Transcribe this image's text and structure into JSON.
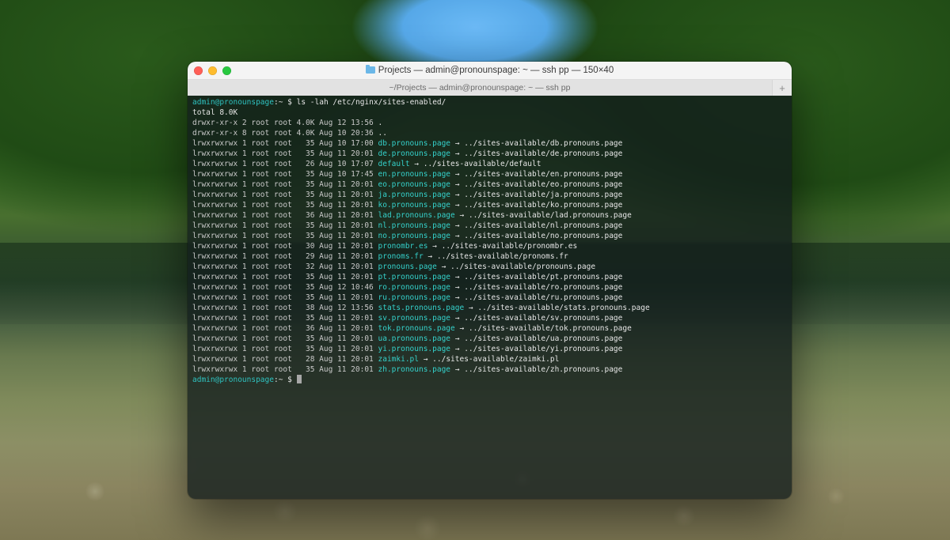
{
  "window": {
    "title_prefix_folder": "Projects",
    "title_rest": " — admin@pronounspage: ~ — ssh pp — 150×40",
    "tab_label": "~/Projects — admin@pronounspage: ~ — ssh pp",
    "add_tab_glyph": "+"
  },
  "prompt": {
    "user": "admin@pronounspage",
    "sep": ":",
    "path": "~",
    "dollar": "$"
  },
  "command1": "ls -lah /etc/nginx/sites-enabled/",
  "total_line": "total 8.0K",
  "entries": [
    {
      "perm": "drwxr-xr-x",
      "links": "2",
      "owner": "root",
      "group": "root",
      "size": "4.0K",
      "date": "Aug 12 13:56",
      "name": ".",
      "is_link": false,
      "target": ""
    },
    {
      "perm": "drwxr-xr-x",
      "links": "8",
      "owner": "root",
      "group": "root",
      "size": "4.0K",
      "date": "Aug 10 20:36",
      "name": "..",
      "is_link": false,
      "target": ""
    },
    {
      "perm": "lrwxrwxrwx",
      "links": "1",
      "owner": "root",
      "group": "root",
      "size": "35",
      "date": "Aug 10 17:00",
      "name": "db.pronouns.page",
      "is_link": true,
      "target": "../sites-available/db.pronouns.page"
    },
    {
      "perm": "lrwxrwxrwx",
      "links": "1",
      "owner": "root",
      "group": "root",
      "size": "35",
      "date": "Aug 11 20:01",
      "name": "de.pronouns.page",
      "is_link": true,
      "target": "../sites-available/de.pronouns.page"
    },
    {
      "perm": "lrwxrwxrwx",
      "links": "1",
      "owner": "root",
      "group": "root",
      "size": "26",
      "date": "Aug 10 17:07",
      "name": "default",
      "is_link": true,
      "target": "../sites-available/default"
    },
    {
      "perm": "lrwxrwxrwx",
      "links": "1",
      "owner": "root",
      "group": "root",
      "size": "35",
      "date": "Aug 10 17:45",
      "name": "en.pronouns.page",
      "is_link": true,
      "target": "../sites-available/en.pronouns.page"
    },
    {
      "perm": "lrwxrwxrwx",
      "links": "1",
      "owner": "root",
      "group": "root",
      "size": "35",
      "date": "Aug 11 20:01",
      "name": "eo.pronouns.page",
      "is_link": true,
      "target": "../sites-available/eo.pronouns.page"
    },
    {
      "perm": "lrwxrwxrwx",
      "links": "1",
      "owner": "root",
      "group": "root",
      "size": "35",
      "date": "Aug 11 20:01",
      "name": "ja.pronouns.page",
      "is_link": true,
      "target": "../sites-available/ja.pronouns.page"
    },
    {
      "perm": "lrwxrwxrwx",
      "links": "1",
      "owner": "root",
      "group": "root",
      "size": "35",
      "date": "Aug 11 20:01",
      "name": "ko.pronouns.page",
      "is_link": true,
      "target": "../sites-available/ko.pronouns.page"
    },
    {
      "perm": "lrwxrwxrwx",
      "links": "1",
      "owner": "root",
      "group": "root",
      "size": "36",
      "date": "Aug 11 20:01",
      "name": "lad.pronouns.page",
      "is_link": true,
      "target": "../sites-available/lad.pronouns.page"
    },
    {
      "perm": "lrwxrwxrwx",
      "links": "1",
      "owner": "root",
      "group": "root",
      "size": "35",
      "date": "Aug 11 20:01",
      "name": "nl.pronouns.page",
      "is_link": true,
      "target": "../sites-available/nl.pronouns.page"
    },
    {
      "perm": "lrwxrwxrwx",
      "links": "1",
      "owner": "root",
      "group": "root",
      "size": "35",
      "date": "Aug 11 20:01",
      "name": "no.pronouns.page",
      "is_link": true,
      "target": "../sites-available/no.pronouns.page"
    },
    {
      "perm": "lrwxrwxrwx",
      "links": "1",
      "owner": "root",
      "group": "root",
      "size": "30",
      "date": "Aug 11 20:01",
      "name": "pronombr.es",
      "is_link": true,
      "target": "../sites-available/pronombr.es"
    },
    {
      "perm": "lrwxrwxrwx",
      "links": "1",
      "owner": "root",
      "group": "root",
      "size": "29",
      "date": "Aug 11 20:01",
      "name": "pronoms.fr",
      "is_link": true,
      "target": "../sites-available/pronoms.fr"
    },
    {
      "perm": "lrwxrwxrwx",
      "links": "1",
      "owner": "root",
      "group": "root",
      "size": "32",
      "date": "Aug 11 20:01",
      "name": "pronouns.page",
      "is_link": true,
      "target": "../sites-available/pronouns.page"
    },
    {
      "perm": "lrwxrwxrwx",
      "links": "1",
      "owner": "root",
      "group": "root",
      "size": "35",
      "date": "Aug 11 20:01",
      "name": "pt.pronouns.page",
      "is_link": true,
      "target": "../sites-available/pt.pronouns.page"
    },
    {
      "perm": "lrwxrwxrwx",
      "links": "1",
      "owner": "root",
      "group": "root",
      "size": "35",
      "date": "Aug 12 10:46",
      "name": "ro.pronouns.page",
      "is_link": true,
      "target": "../sites-available/ro.pronouns.page"
    },
    {
      "perm": "lrwxrwxrwx",
      "links": "1",
      "owner": "root",
      "group": "root",
      "size": "35",
      "date": "Aug 11 20:01",
      "name": "ru.pronouns.page",
      "is_link": true,
      "target": "../sites-available/ru.pronouns.page"
    },
    {
      "perm": "lrwxrwxrwx",
      "links": "1",
      "owner": "root",
      "group": "root",
      "size": "38",
      "date": "Aug 12 13:56",
      "name": "stats.pronouns.page",
      "is_link": true,
      "target": "../sites-available/stats.pronouns.page"
    },
    {
      "perm": "lrwxrwxrwx",
      "links": "1",
      "owner": "root",
      "group": "root",
      "size": "35",
      "date": "Aug 11 20:01",
      "name": "sv.pronouns.page",
      "is_link": true,
      "target": "../sites-available/sv.pronouns.page"
    },
    {
      "perm": "lrwxrwxrwx",
      "links": "1",
      "owner": "root",
      "group": "root",
      "size": "36",
      "date": "Aug 11 20:01",
      "name": "tok.pronouns.page",
      "is_link": true,
      "target": "../sites-available/tok.pronouns.page"
    },
    {
      "perm": "lrwxrwxrwx",
      "links": "1",
      "owner": "root",
      "group": "root",
      "size": "35",
      "date": "Aug 11 20:01",
      "name": "ua.pronouns.page",
      "is_link": true,
      "target": "../sites-available/ua.pronouns.page"
    },
    {
      "perm": "lrwxrwxrwx",
      "links": "1",
      "owner": "root",
      "group": "root",
      "size": "35",
      "date": "Aug 11 20:01",
      "name": "yi.pronouns.page",
      "is_link": true,
      "target": "../sites-available/yi.pronouns.page"
    },
    {
      "perm": "lrwxrwxrwx",
      "links": "1",
      "owner": "root",
      "group": "root",
      "size": "28",
      "date": "Aug 11 20:01",
      "name": "zaimki.pl",
      "is_link": true,
      "target": "../sites-available/zaimki.pl"
    },
    {
      "perm": "lrwxrwxrwx",
      "links": "1",
      "owner": "root",
      "group": "root",
      "size": "35",
      "date": "Aug 11 20:01",
      "name": "zh.pronouns.page",
      "is_link": true,
      "target": "../sites-available/zh.pronouns.page"
    }
  ],
  "arrow": "→"
}
